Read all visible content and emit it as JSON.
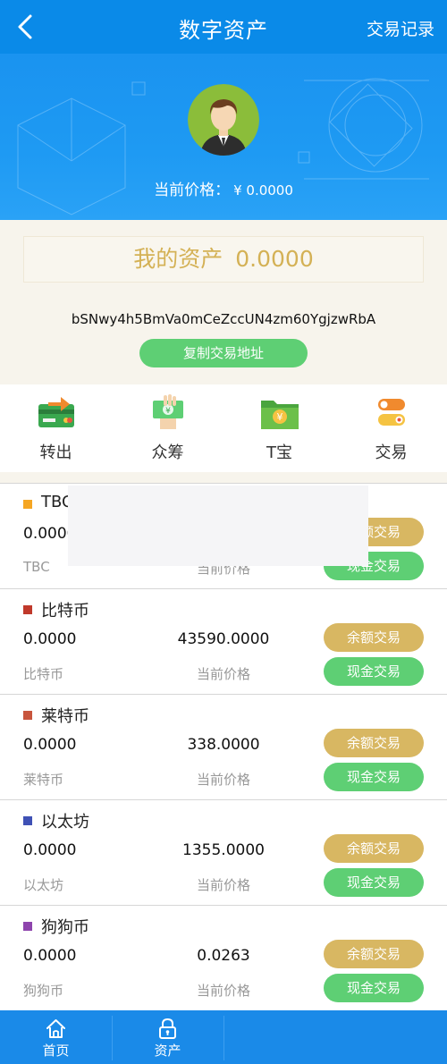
{
  "header": {
    "title": "数字资产",
    "record_label": "交易记录",
    "back_icon": "chevron-left-icon"
  },
  "hero": {
    "price_label": "当前价格：",
    "price_value": "¥ 0.0000"
  },
  "assets": {
    "label": "我的资产",
    "amount": "0.0000",
    "address": "bSNwy4h5BmVa0mCeZccUN4zm60YgjzwRbA",
    "copy_button": "复制交易地址"
  },
  "actions": [
    {
      "label": "转出",
      "icon": "transfer-card-icon"
    },
    {
      "label": "众筹",
      "icon": "crowdfund-hand-icon"
    },
    {
      "label": "T宝",
      "icon": "folder-yen-icon"
    },
    {
      "label": "交易",
      "icon": "toggle-icon"
    }
  ],
  "coins": [
    {
      "name": "TBC",
      "color": "#f5a623",
      "balance": "0.0000",
      "price": "",
      "sub": "TBC",
      "price_label": "当前价格",
      "btn_balance": "余额交易",
      "btn_cash": "现金交易"
    },
    {
      "name": "比特币",
      "color": "#c0392b",
      "balance": "0.0000",
      "price": "43590.0000",
      "sub": "比特币",
      "price_label": "当前价格",
      "btn_balance": "余额交易",
      "btn_cash": "现金交易"
    },
    {
      "name": "莱特币",
      "color": "#c8553d",
      "balance": "0.0000",
      "price": "338.0000",
      "sub": "莱特币",
      "price_label": "当前价格",
      "btn_balance": "余额交易",
      "btn_cash": "现金交易"
    },
    {
      "name": "以太坊",
      "color": "#3f51b5",
      "balance": "0.0000",
      "price": "1355.0000",
      "sub": "以太坊",
      "price_label": "当前价格",
      "btn_balance": "余额交易",
      "btn_cash": "现金交易"
    },
    {
      "name": "狗狗币",
      "color": "#8e44ad",
      "balance": "0.0000",
      "price": "0.0263",
      "sub": "狗狗币",
      "price_label": "当前价格",
      "btn_balance": "余额交易",
      "btn_cash": "现金交易"
    }
  ],
  "tabbar": [
    {
      "label": "首页",
      "icon": "home-icon"
    },
    {
      "label": "资产",
      "icon": "lock-icon"
    }
  ]
}
